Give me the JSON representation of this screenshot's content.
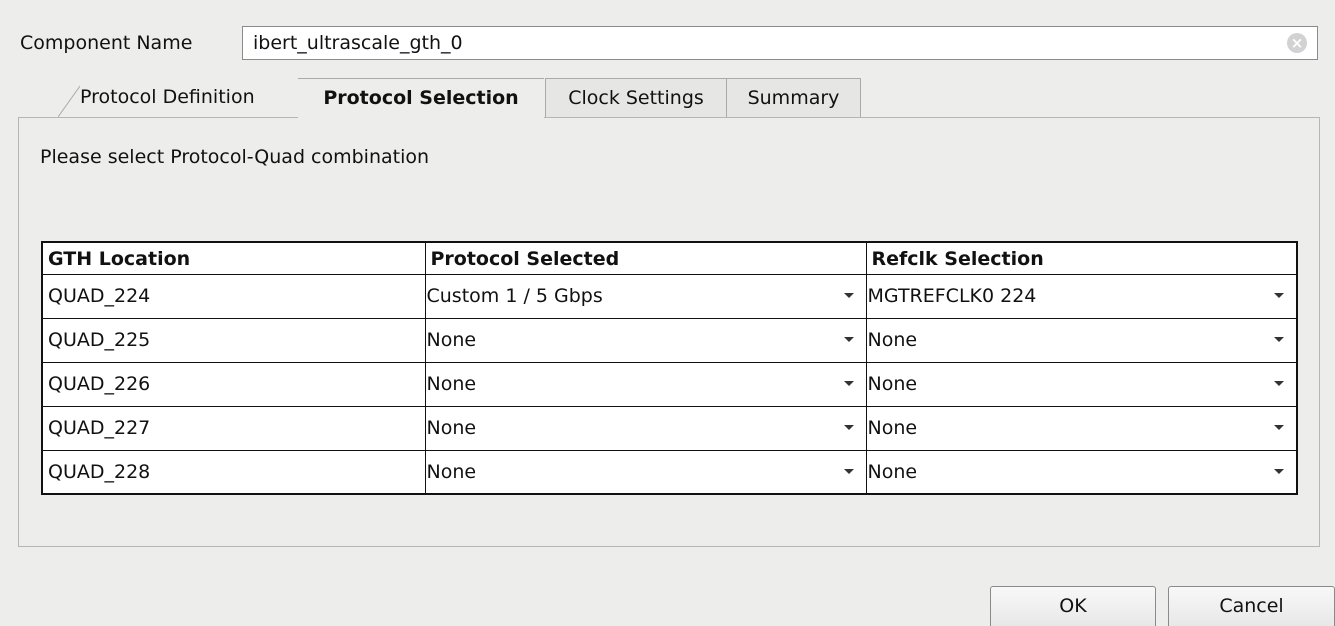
{
  "component": {
    "label": "Component Name",
    "value": "ibert_ultrascale_gth_0"
  },
  "tabs": [
    {
      "label": "Protocol Definition",
      "active": false
    },
    {
      "label": "Protocol Selection",
      "active": true
    },
    {
      "label": "Clock Settings",
      "active": false
    },
    {
      "label": "Summary",
      "active": false
    }
  ],
  "instruction": "Please select Protocol-Quad combination",
  "table": {
    "headers": [
      "GTH Location",
      "Protocol Selected",
      "Refclk Selection"
    ],
    "rows": [
      {
        "location": "QUAD_224",
        "protocol": "Custom 1 / 5 Gbps",
        "refclk": "MGTREFCLK0 224"
      },
      {
        "location": "QUAD_225",
        "protocol": "None",
        "refclk": "None"
      },
      {
        "location": "QUAD_226",
        "protocol": "None",
        "refclk": "None"
      },
      {
        "location": "QUAD_227",
        "protocol": "None",
        "refclk": "None"
      },
      {
        "location": "QUAD_228",
        "protocol": "None",
        "refclk": "None"
      }
    ]
  },
  "buttons": {
    "ok": "OK",
    "cancel": "Cancel"
  },
  "icons": {
    "clear": "clear-icon",
    "dropdown": "chevron-down-icon"
  }
}
